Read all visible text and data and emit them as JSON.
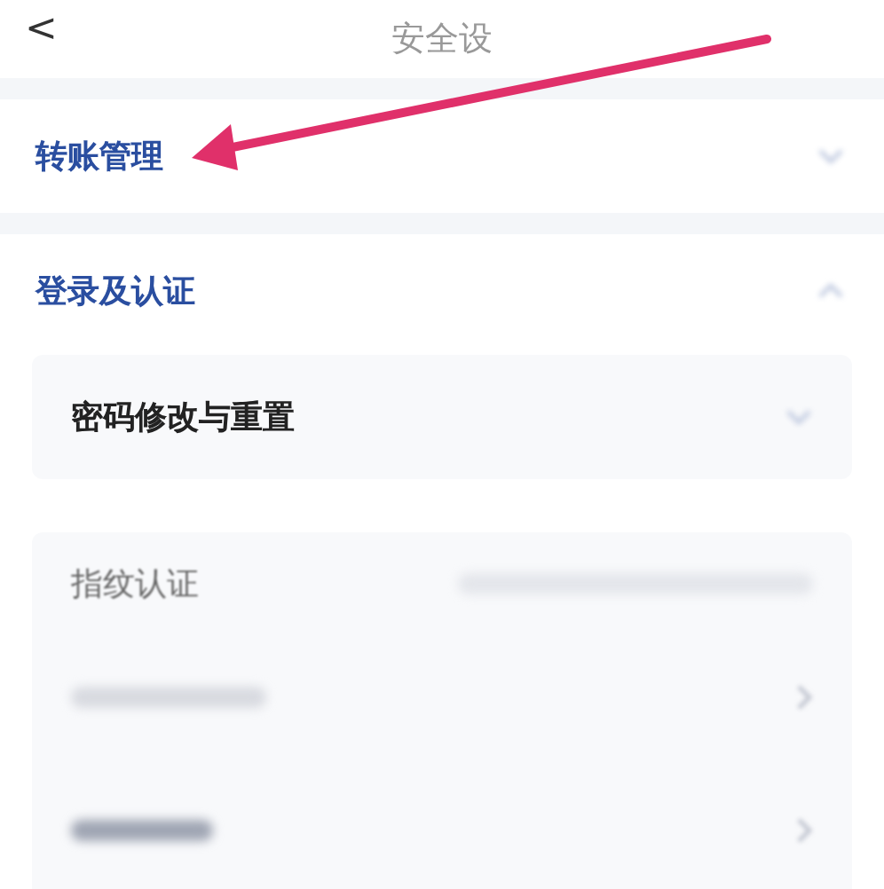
{
  "header": {
    "back": "<",
    "title": "安全设"
  },
  "sections": [
    {
      "title": "转账管理",
      "expanded": false
    },
    {
      "title": "登录及认证",
      "expanded": true,
      "items": [
        {
          "kind": "link",
          "label": "密码修改与重置"
        },
        {
          "kind": "group",
          "label": "指纹认证"
        }
      ]
    }
  ]
}
